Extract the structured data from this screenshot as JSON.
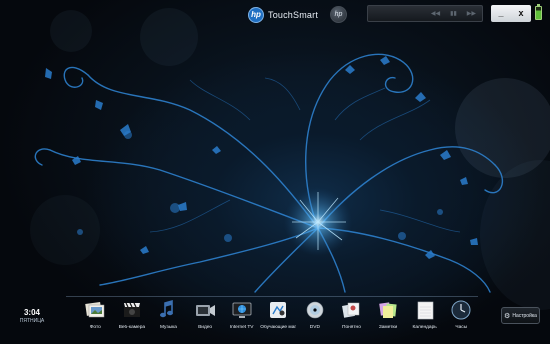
{
  "header": {
    "brand": "TouchSmart",
    "logo_text": "hp",
    "round_button_text": "hp"
  },
  "media_controls": [
    "back",
    "pause",
    "forward"
  ],
  "window_controls": {
    "minimize": "_",
    "close": "x"
  },
  "battery": {
    "charge_fraction": 0.7,
    "color": "#5fbf3a"
  },
  "clock": {
    "time": "3:04",
    "day": "ПЯТНИЦА"
  },
  "dock": {
    "items": [
      {
        "label": "Фото",
        "icon": "photo-icon"
      },
      {
        "label": "Веб-камера",
        "icon": "webcam-icon"
      },
      {
        "label": "Музыка",
        "icon": "music-icon"
      },
      {
        "label": "Видео",
        "icon": "video-icon"
      },
      {
        "label": "Internet TV",
        "icon": "internet-tv-icon"
      },
      {
        "label": "Обучающие маг...",
        "icon": "tutorials-icon"
      },
      {
        "label": "DVD",
        "icon": "dvd-icon"
      },
      {
        "label": "Понятно",
        "icon": "canvas-icon"
      },
      {
        "label": "Заметки",
        "icon": "notes-icon"
      },
      {
        "label": "Календарь",
        "icon": "calendar-icon"
      },
      {
        "label": "Часы",
        "icon": "clock-icon"
      }
    ]
  },
  "settings": {
    "label": "Настройка"
  },
  "colors": {
    "background": "#05080d",
    "artwork": "#2f86d6",
    "glow": "#8fd6ff"
  }
}
